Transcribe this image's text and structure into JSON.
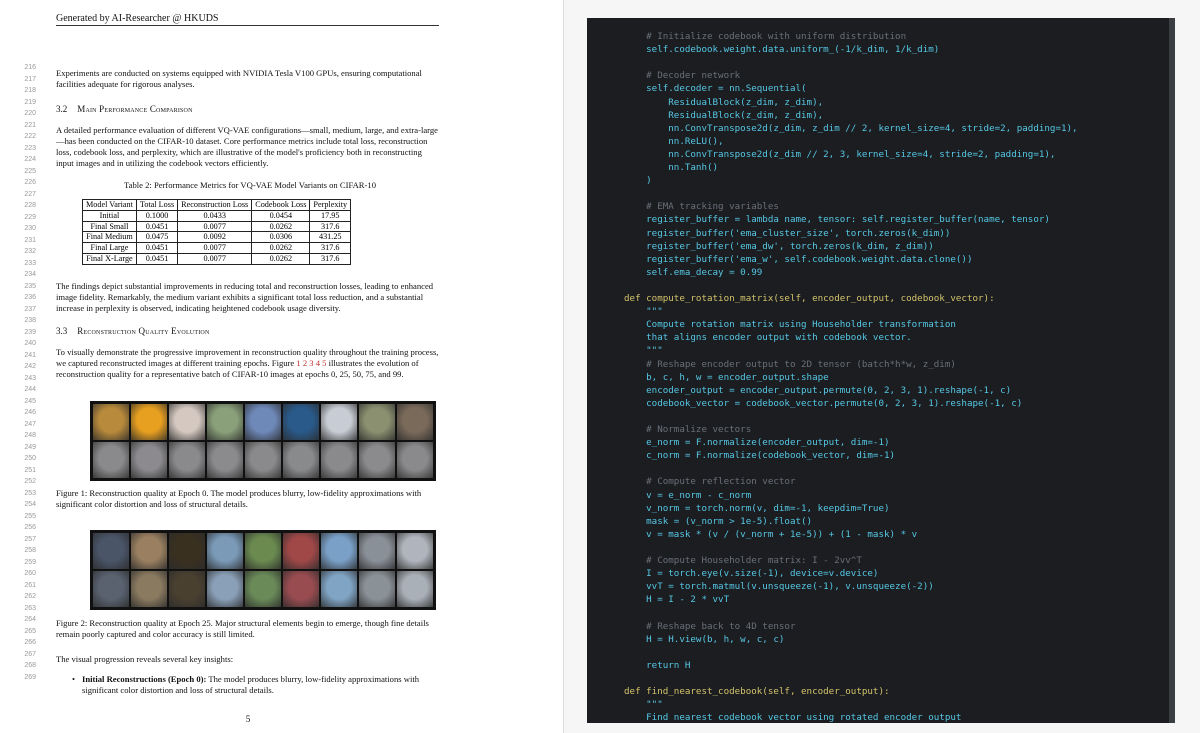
{
  "paper": {
    "header": "Generated by AI-Researcher @ HKUDS",
    "intro_text": "Experiments are conducted on systems equipped with NVIDIA Tesla V100 GPUs, ensuring computational facilities adequate for rigorous analyses.",
    "section_32": {
      "num": "3.2",
      "title": "Main Performance Comparison"
    },
    "para_32": "A detailed performance evaluation of different VQ-VAE configurations—small, medium, large, and extra-large—has been conducted on the CIFAR-10 dataset. Core performance metrics include total loss, reconstruction loss, codebook loss, and perplexity, which are illustrative of the model's proficiency both in reconstructing input images and in utilizing the codebook vectors efficiently.",
    "table_caption": "Table 2: Performance Metrics for VQ-VAE Model Variants on CIFAR-10",
    "table": {
      "headers": [
        "Model Variant",
        "Total Loss",
        "Reconstruction Loss",
        "Codebook Loss",
        "Perplexity"
      ],
      "rows": [
        [
          "Initial",
          "0.1000",
          "0.0433",
          "0.0454",
          "17.95"
        ],
        [
          "Final Small",
          "0.0451",
          "0.0077",
          "0.0262",
          "317.6"
        ],
        [
          "Final Medium",
          "0.0475",
          "0.0092",
          "0.0306",
          "431.25"
        ],
        [
          "Final Large",
          "0.0451",
          "0.0077",
          "0.0262",
          "317.6"
        ],
        [
          "Final X-Large",
          "0.0451",
          "0.0077",
          "0.0262",
          "317.6"
        ]
      ]
    },
    "para_findings": "The findings depict substantial improvements in reducing total and reconstruction losses, leading to enhanced image fidelity. Remarkably, the medium variant exhibits a significant total loss reduction, and a substantial increase in perplexity is observed, indicating heightened codebook usage diversity.",
    "section_33": {
      "num": "3.3",
      "title": "Reconstruction Quality Evolution"
    },
    "para_33_a": "To visually demonstrate the progressive improvement in reconstruction quality throughout the training process, we captured reconstructed images at different training epochs. Figure ",
    "para_33_refs": "1 2 3 4 5",
    "para_33_b": " illustrates the evolution of reconstruction quality for a representative batch of CIFAR-10 images at epochs 0, 25, 50, 75, and 99.",
    "fig1_caption": "Figure 1: Reconstruction quality at Epoch 0. The model produces blurry, low-fidelity approximations with significant color distortion and loss of structural details.",
    "fig2_caption": "Figure 2: Reconstruction quality at Epoch 25. Major structural elements begin to emerge, though fine details remain poorly captured and color accuracy is still limited.",
    "para_insights": "The visual progression reveals several key insights:",
    "bullet_bold": "Initial Reconstructions (Epoch 0):",
    "bullet_text": " The model produces blurry, low-fidelity approximations with significant color distortion and loss of structural details.",
    "page_number": "5",
    "line_numbers": [
      "216",
      "217",
      "218",
      "219",
      "220",
      "221",
      "222",
      "223",
      "224",
      "225",
      "226",
      "227",
      "228",
      "229",
      "230",
      "231",
      "232",
      "233",
      "234",
      "235",
      "236",
      "237",
      "238",
      "239",
      "240",
      "241",
      "242",
      "243",
      "244",
      "245",
      "246",
      "247",
      "248",
      "249",
      "250",
      "251",
      "252",
      "253",
      "254",
      "255",
      "256",
      "257",
      "258",
      "259",
      "260",
      "261",
      "262",
      "263",
      "264",
      "265",
      "266",
      "267",
      "268",
      "269"
    ]
  },
  "figure_colors": {
    "fig1_top": [
      "#b88a3c",
      "#e8a020",
      "#d4c8c0",
      "#8aa07a",
      "#6e88b8",
      "#2a5a8a",
      "#c8ccd4",
      "#8a9070",
      "#7a6a5a"
    ],
    "fig1_bottom": [
      "#8a8a8c",
      "#8c8a8e",
      "#8a898c",
      "#8b8a8d",
      "#8a8a8c",
      "#898a8c",
      "#8a8a8d",
      "#8b8a8c",
      "#8a8a8c"
    ],
    "fig2_top": [
      "#4a5568",
      "#9a8060",
      "#3a3020",
      "#7a9ab8",
      "#6a8a50",
      "#a04848",
      "#7aa0c8",
      "#8a9098",
      "#b0b4bc"
    ],
    "fig2_bottom": [
      "#5a6270",
      "#8a7a60",
      "#4a4030",
      "#8aa0b8",
      "#6a8a58",
      "#984c50",
      "#80a4c4",
      "#8a9298",
      "#aab0b8"
    ]
  },
  "code": {
    "lines": [
      {
        "t": "    # Initialize codebook with uniform distribution",
        "c": "cm"
      },
      {
        "t": "    self.codebook.weight.data.uniform_(-1/k_dim, 1/k_dim)",
        "c": ""
      },
      {
        "t": "",
        "c": ""
      },
      {
        "t": "    # Decoder network",
        "c": "cm"
      },
      {
        "t": "    self.decoder = nn.Sequential(",
        "c": ""
      },
      {
        "t": "        ResidualBlock(z_dim, z_dim),",
        "c": ""
      },
      {
        "t": "        ResidualBlock(z_dim, z_dim),",
        "c": ""
      },
      {
        "t": "        nn.ConvTranspose2d(z_dim, z_dim // 2, kernel_size=4, stride=2, padding=1),",
        "c": ""
      },
      {
        "t": "        nn.ReLU(),",
        "c": ""
      },
      {
        "t": "        nn.ConvTranspose2d(z_dim // 2, 3, kernel_size=4, stride=2, padding=1),",
        "c": ""
      },
      {
        "t": "        nn.Tanh()",
        "c": ""
      },
      {
        "t": "    )",
        "c": ""
      },
      {
        "t": "",
        "c": ""
      },
      {
        "t": "    # EMA tracking variables",
        "c": "cm"
      },
      {
        "t": "    register_buffer = lambda name, tensor: self.register_buffer(name, tensor)",
        "c": ""
      },
      {
        "t": "    register_buffer('ema_cluster_size', torch.zeros(k_dim))",
        "c": ""
      },
      {
        "t": "    register_buffer('ema_dw', torch.zeros(k_dim, z_dim))",
        "c": ""
      },
      {
        "t": "    register_buffer('ema_w', self.codebook.weight.data.clone())",
        "c": ""
      },
      {
        "t": "    self.ema_decay = 0.99",
        "c": ""
      },
      {
        "t": "",
        "c": ""
      },
      {
        "t": "def compute_rotation_matrix(self, encoder_output, codebook_vector):",
        "c": "kw"
      },
      {
        "t": "    \"\"\"",
        "c": ""
      },
      {
        "t": "    Compute rotation matrix using Householder transformation",
        "c": ""
      },
      {
        "t": "    that aligns encoder output with codebook vector.",
        "c": ""
      },
      {
        "t": "    \"\"\"",
        "c": ""
      },
      {
        "t": "    # Reshape encoder output to 2D tensor (batch*h*w, z_dim)",
        "c": "cm"
      },
      {
        "t": "    b, c, h, w = encoder_output.shape",
        "c": ""
      },
      {
        "t": "    encoder_output = encoder_output.permute(0, 2, 3, 1).reshape(-1, c)",
        "c": ""
      },
      {
        "t": "    codebook_vector = codebook_vector.permute(0, 2, 3, 1).reshape(-1, c)",
        "c": ""
      },
      {
        "t": "",
        "c": ""
      },
      {
        "t": "    # Normalize vectors",
        "c": "cm"
      },
      {
        "t": "    e_norm = F.normalize(encoder_output, dim=-1)",
        "c": ""
      },
      {
        "t": "    c_norm = F.normalize(codebook_vector, dim=-1)",
        "c": ""
      },
      {
        "t": "",
        "c": ""
      },
      {
        "t": "    # Compute reflection vector",
        "c": "cm"
      },
      {
        "t": "    v = e_norm - c_norm",
        "c": ""
      },
      {
        "t": "    v_norm = torch.norm(v, dim=-1, keepdim=True)",
        "c": ""
      },
      {
        "t": "    mask = (v_norm > 1e-5).float()",
        "c": ""
      },
      {
        "t": "    v = mask * (v / (v_norm + 1e-5)) + (1 - mask) * v",
        "c": ""
      },
      {
        "t": "",
        "c": ""
      },
      {
        "t": "    # Compute Householder matrix: I - 2vv^T",
        "c": "cm"
      },
      {
        "t": "    I = torch.eye(v.size(-1), device=v.device)",
        "c": ""
      },
      {
        "t": "    vvT = torch.matmul(v.unsqueeze(-1), v.unsqueeze(-2))",
        "c": ""
      },
      {
        "t": "    H = I - 2 * vvT",
        "c": ""
      },
      {
        "t": "",
        "c": ""
      },
      {
        "t": "    # Reshape back to 4D tensor",
        "c": "cm"
      },
      {
        "t": "    H = H.view(b, h, w, c, c)",
        "c": ""
      },
      {
        "t": "",
        "c": ""
      },
      {
        "t": "    return H",
        "c": ""
      },
      {
        "t": "",
        "c": ""
      },
      {
        "t": "def find_nearest_codebook(self, encoder_output):",
        "c": "kw"
      },
      {
        "t": "    \"\"\"",
        "c": ""
      },
      {
        "t": "    Find nearest codebook vector using rotated encoder output",
        "c": ""
      }
    ]
  }
}
